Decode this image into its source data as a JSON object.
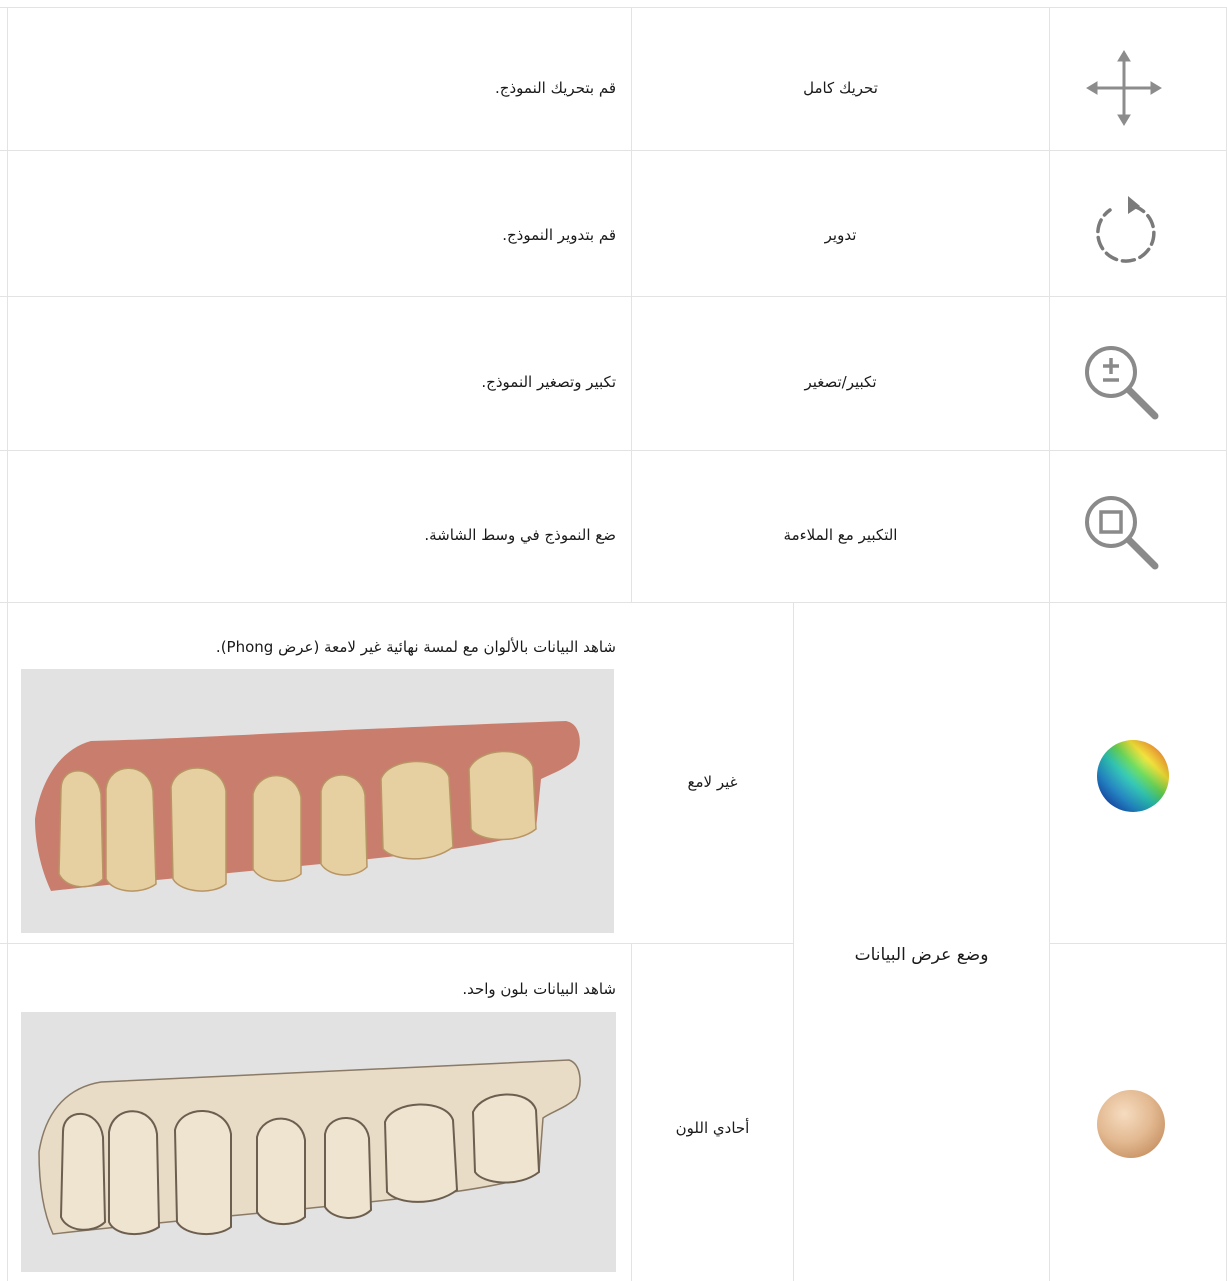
{
  "rows": [
    {
      "icon": "move-arrows-icon",
      "function": "تحريك كامل",
      "description": "قم بتحريك النموذج."
    },
    {
      "icon": "rotate-icon",
      "function": "تدوير",
      "description": "قم بتدوير النموذج."
    },
    {
      "icon": "zoom-plus-minus-icon",
      "function": "تكبير/تصغير",
      "description": "تكبير وتصغير النموذج."
    },
    {
      "icon": "zoom-fit-icon",
      "function": "التكبير مع الملاءمة",
      "description": "ضع النموذج في وسط الشاشة."
    }
  ],
  "display_mode": {
    "group_label": "وضع عرض البيانات",
    "options": [
      {
        "icon": "color-sphere-icon",
        "label": "غير لامع",
        "description": "شاهد البيانات بالألوان مع لمسة نهائية غير لامعة (عرض Phong).",
        "image": "colored-teeth-model"
      },
      {
        "icon": "mono-sphere-icon",
        "label": "أحادي اللون",
        "description": "شاهد البيانات بلون واحد.",
        "image": "monochrome-teeth-model"
      }
    ]
  },
  "colors": {
    "border": "#e3e3e3",
    "photo_bg": "#e2e2e2",
    "gum": "#c97d6d",
    "tooth_color": "#e6cfa0",
    "tooth_mono": "#e8dcc6",
    "sphere_mono": "#e2b890"
  }
}
